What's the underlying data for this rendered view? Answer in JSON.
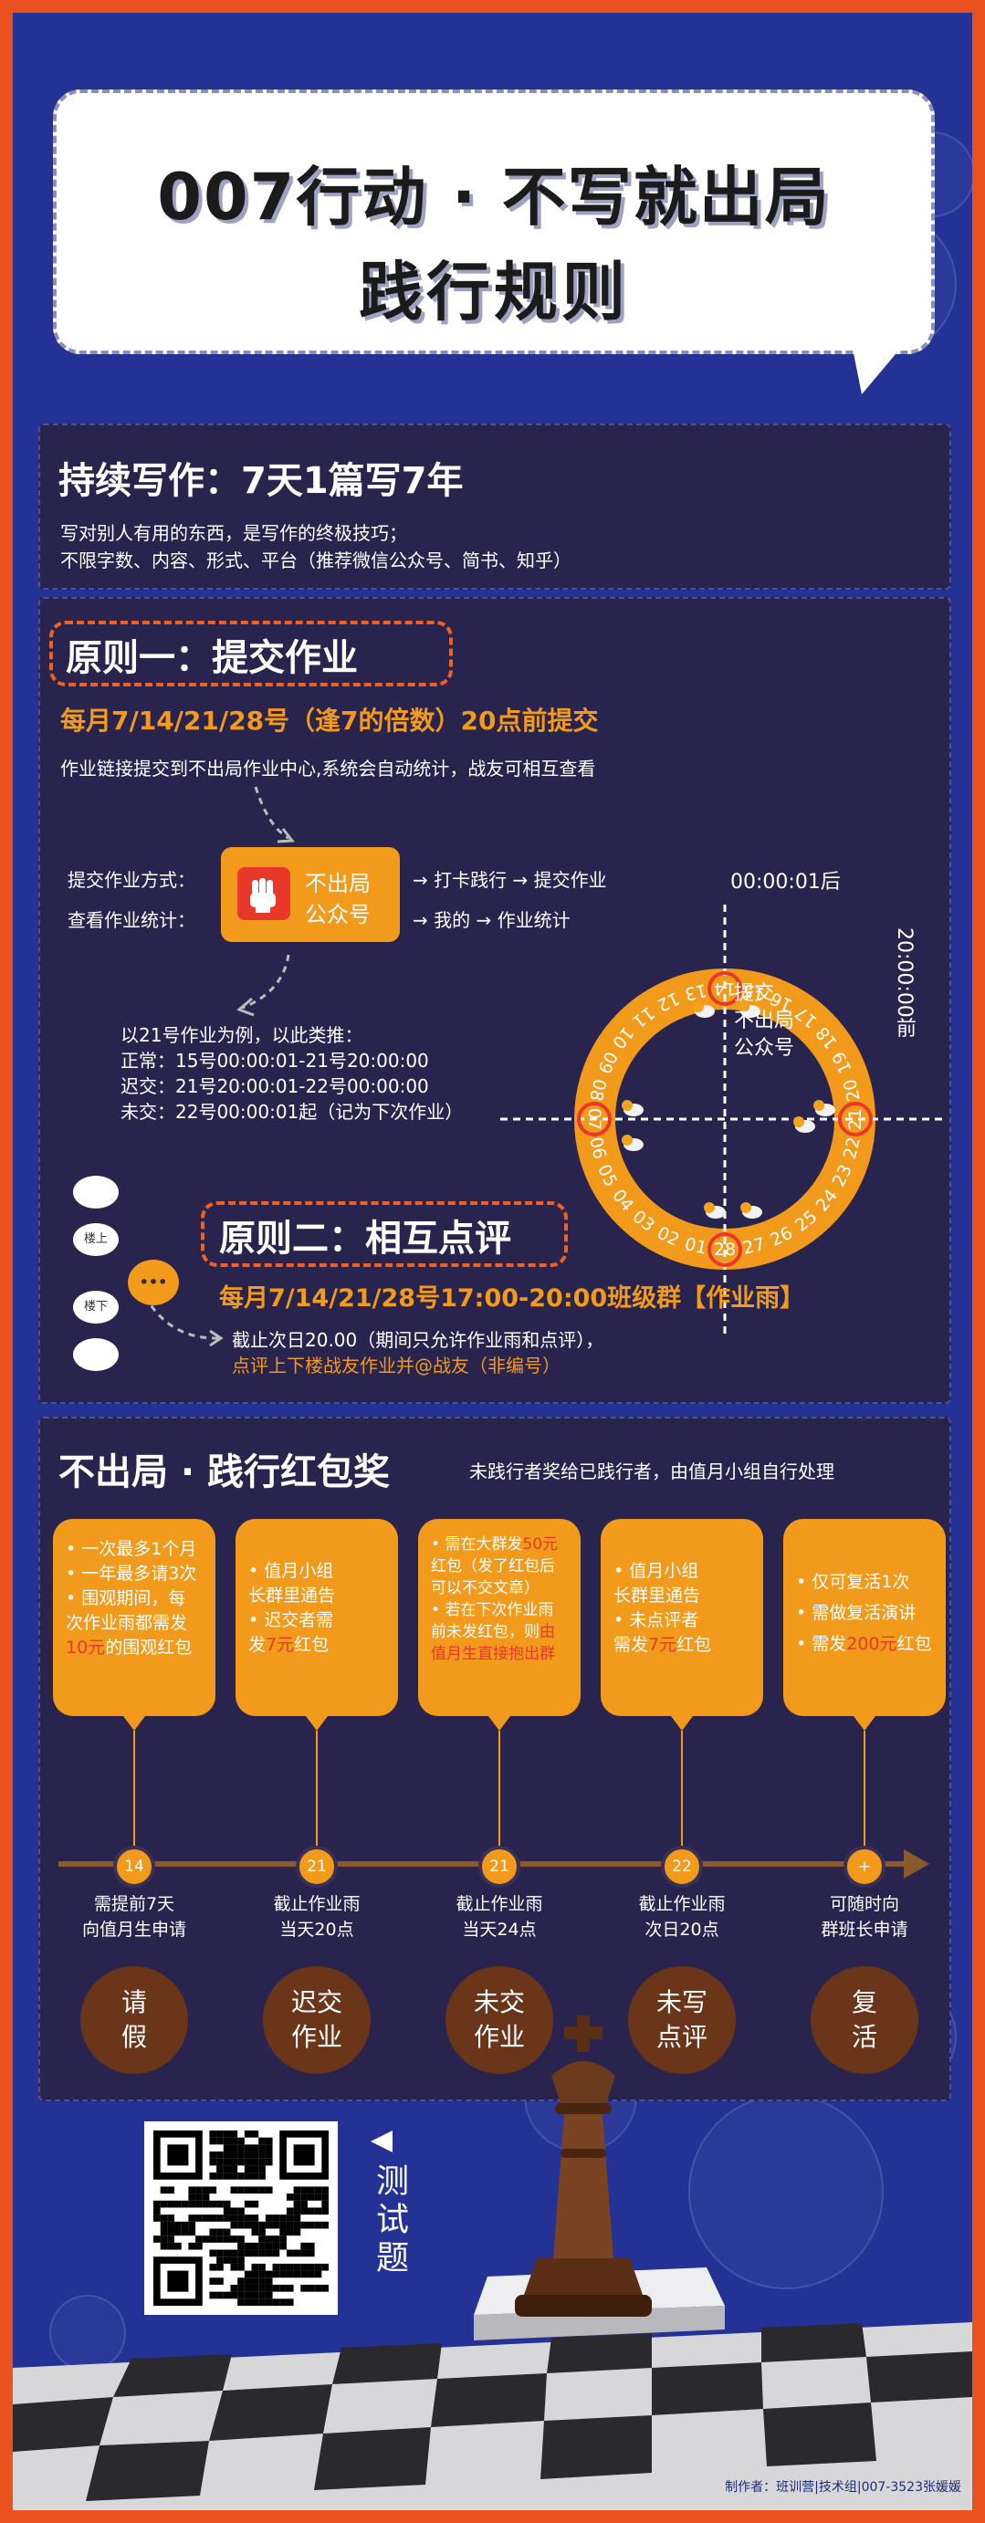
{
  "header": {
    "title_line1": "007行动 · 不写就出局",
    "title_line2": "践行规则"
  },
  "intro": {
    "title": "持续写作：7天1篇写7年",
    "line1": "写对别人有用的东西，是写作的终极技巧；",
    "line2": "不限字数、内容、形式、平台（推荐微信公众号、简书、知乎）"
  },
  "rule1": {
    "title": "原则一：提交作业",
    "deadline": "每月7/14/21/28号（逢7的倍数）20点前提交",
    "desc": "作业链接提交到不出局作业中心,系统会自动统计，战友可相互查看",
    "submit_label": "提交作业方式：",
    "view_label": "查看作业统计：",
    "app_name_line1": "不出局",
    "app_name_line2": "公众号",
    "submit_path": "→ 打卡践行 → 提交作业",
    "view_path": "→ 我的 → 作业统计",
    "example_title": "以21号作业为例，以此类推：",
    "example_normal": "正常：15号00:00:01-21号20:00:00",
    "example_late": "迟交：21号20:00:01-22号00:00:00",
    "example_missing": "未交：22号00:00:01起（记为下次作业）"
  },
  "clock": {
    "label_after": "00:00:01后",
    "label_before": "20:00:00前",
    "center_line1": "提交",
    "center_line2": "不出局",
    "center_line3": "公众号",
    "days": [
      "01",
      "02",
      "03",
      "04",
      "05",
      "06",
      "07",
      "08",
      "09",
      "10",
      "11",
      "12",
      "13",
      "14",
      "15",
      "16",
      "17",
      "18",
      "19",
      "20",
      "21",
      "22",
      "23",
      "24",
      "25",
      "26",
      "27",
      "28"
    ],
    "highlighted": [
      "07",
      "14",
      "21",
      "28"
    ],
    "ring_color": "#f29a1c",
    "highlight_color": "#e8382a"
  },
  "rule2": {
    "title": "原则二：相互点评",
    "schedule": "每月7/14/21/28号17:00-20:00班级群【作业雨】",
    "note1": "截止次日20.00（期间只允许作业雨和点评），",
    "note2": "点评上下楼战友作业并@战友（非编号）",
    "chat_upstairs": "楼上",
    "chat_downstairs": "楼下",
    "chat_dots": "•••"
  },
  "rewards": {
    "title": "不出局 · 践行红包奖",
    "subtitle": "未践行者奖给已践行者，由值月小组自行处理",
    "cards": [
      {
        "l1": "• 一次最多1个月",
        "l2": "• 一年最多请3次",
        "l3": "• 围观期间，每",
        "l4": "次作业雨都需发",
        "l5a": "10元",
        "l5b": "的围观红包"
      },
      {
        "l1": "• 值月小组",
        "l2": "长群里通告",
        "l3": "• 迟交者需",
        "l4a": "发",
        "l4b": "7元",
        "l4c": "红包"
      },
      {
        "l1a": "• 需在大群发",
        "l1b": "50元",
        "l2": "红包（发了红包后",
        "l3": "可以不交文章）",
        "l4": "• 若在下次作业雨",
        "l5a": "前未发红包，则",
        "l5b": "由",
        "l6": "值月生直接抱出群"
      },
      {
        "l1": "• 值月小组",
        "l2": "长群里通告",
        "l3": "• 未点评者",
        "l4a": "需发",
        "l4b": "7元",
        "l4c": "红包"
      },
      {
        "l1": "• 仅可复活1次",
        "l2": "• 需做复活演讲",
        "l3a": "• 需发",
        "l3b": "200元",
        "l3c": "红包"
      }
    ],
    "nodes": [
      "14",
      "21",
      "21",
      "22",
      "+"
    ],
    "captions": [
      [
        "需提前7天",
        "向值月生申请"
      ],
      [
        "截止作业雨",
        "当天20点"
      ],
      [
        "截止作业雨",
        "当天24点"
      ],
      [
        "截止作业雨",
        "次日20点"
      ],
      [
        "可随时向",
        "群班长申请"
      ]
    ],
    "outcomes": [
      [
        "请",
        "假"
      ],
      [
        "迟交",
        "作业"
      ],
      [
        "未交",
        "作业"
      ],
      [
        "未写",
        "点评"
      ],
      [
        "复",
        "活"
      ]
    ]
  },
  "footer": {
    "quiz_label": "测试题",
    "credit": "制作者：班训营|技术组|007-3523张媛媛"
  }
}
